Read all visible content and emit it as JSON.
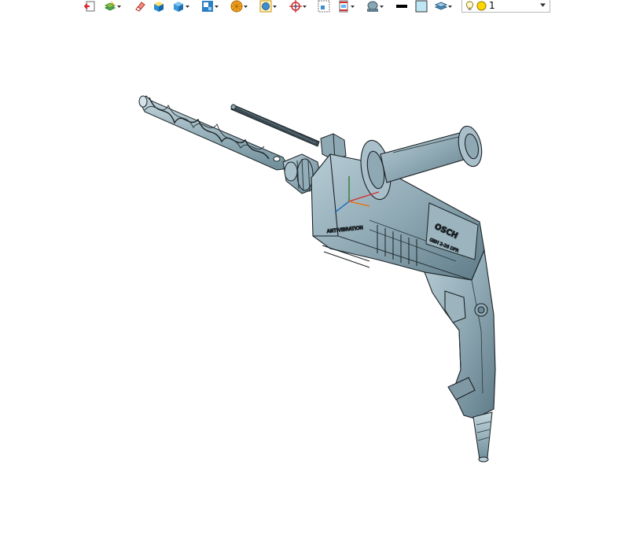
{
  "toolbar": {
    "items": [
      {
        "name": "exit-sketch-icon",
        "dropdown": false
      },
      {
        "name": "sketch-layers-icon",
        "dropdown": true
      },
      {
        "name": "eraser-icon",
        "dropdown": false
      },
      {
        "name": "shaded-cube-icon",
        "dropdown": false
      },
      {
        "name": "blue-cube-icon",
        "dropdown": true
      },
      {
        "name": "view-orientation-icon",
        "dropdown": true
      },
      {
        "name": "render-style-icon",
        "dropdown": true
      },
      {
        "name": "display-filter-icon",
        "dropdown": true
      },
      {
        "name": "snap-target-icon",
        "dropdown": true
      },
      {
        "name": "zoom-fit-icon",
        "dropdown": false
      },
      {
        "name": "section-view-icon",
        "dropdown": true
      },
      {
        "name": "background-color-icon",
        "dropdown": true
      },
      {
        "name": "line-color-swatch",
        "dropdown": false
      },
      {
        "name": "fill-color-swatch",
        "dropdown": false
      },
      {
        "name": "layer-stack-icon",
        "dropdown": true
      }
    ],
    "colors": {
      "line": "#000000",
      "fill": "#bfe6f5"
    }
  },
  "layer_selector": {
    "value": "1",
    "icons": [
      "lightbulb-icon",
      "yellow-circle-icon"
    ]
  },
  "model": {
    "body_color": "#8fa9b4",
    "body_shadow": "#6e8c98",
    "edge_color": "#1b2226",
    "brand_text": "OSCH",
    "model_text": "GBH 2-26 DFR"
  }
}
